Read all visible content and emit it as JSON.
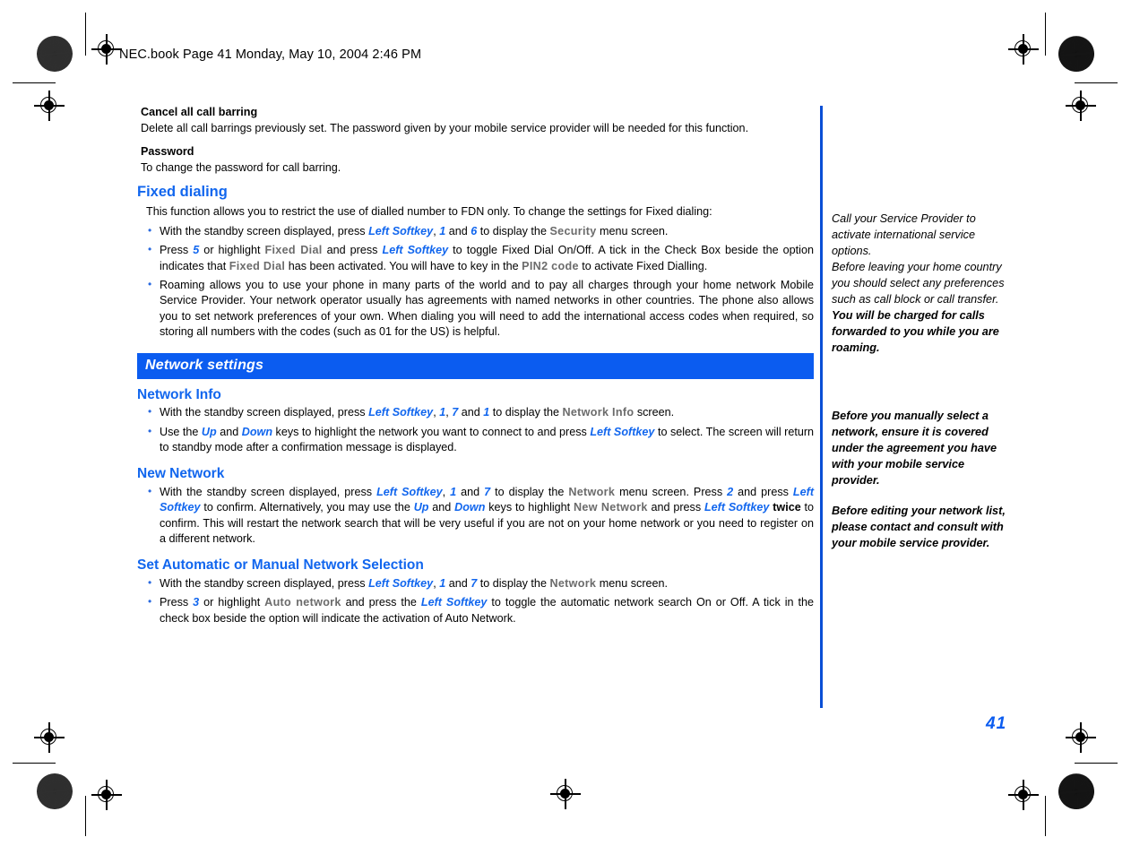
{
  "header": {
    "file_info": "NEC.book  Page 41  Monday, May 10, 2004  2:46 PM"
  },
  "page_number": "41",
  "colors": {
    "accent_blue": "#1166ee",
    "banner_blue": "#0b5cf0",
    "menu_gray": "#6b6b6b",
    "divider_blue": "#0a4fd6"
  },
  "content": {
    "cancel_barring": {
      "heading": "Cancel all call barring",
      "body": "Delete all call barrings previously set. The password given by your mobile service provider will be needed for this function."
    },
    "password": {
      "heading": "Password",
      "body": "To change the password for call barring."
    },
    "fixed_dialing": {
      "heading": "Fixed dialing",
      "intro": "This function allows you to restrict the use of dialled number to FDN only. To change the settings for Fixed dialing:",
      "bullet1": {
        "p1": "With the standby screen displayed, press ",
        "softkey": "Left Softkey",
        "p2": ", ",
        "n1": "1",
        "p3": " and ",
        "n2": "6",
        "p4": " to display the ",
        "menu": "Security",
        "p5": " menu screen."
      },
      "bullet2": {
        "p1": "Press ",
        "n1": "5",
        "p2": " or highlight ",
        "menu1": "Fixed Dial",
        "p3": " and press ",
        "softkey": "Left Softkey",
        "p4": " to toggle Fixed Dial On/Off. A tick in the Check Box beside the option indicates that ",
        "menu2": "Fixed Dial",
        "p5": " has been activated. You will have to key in the ",
        "menu3": "PIN2 code",
        "p6": " to activate Fixed Dialling."
      },
      "bullet3": {
        "text": "Roaming allows you to use your phone in many parts of the world and to pay all charges through your home network Mobile Service Provider. Your network operator usually has agreements with named networks in other countries. The phone also allows you to set network preferences of your own. When dialing you will need to add the international access codes when required, so storing all numbers with the codes (such as 01 for the US) is helpful."
      }
    },
    "network_settings_banner": "Network settings",
    "network_info": {
      "heading": "Network Info",
      "bullet1": {
        "p1": "With the standby screen displayed, press ",
        "softkey": "Left Softkey",
        "p2": ", ",
        "n1": "1",
        "p3": ", ",
        "n2": "7",
        "p4": " and ",
        "n3": "1",
        "p5": " to display the ",
        "menu": "Network Info",
        "p6": " screen."
      },
      "bullet2": {
        "p1": "Use the ",
        "key1": "Up",
        "p2": " and ",
        "key2": "Down",
        "p3": " keys to highlight the network you want to connect to and press ",
        "softkey": "Left Softkey",
        "p4": " to select. The screen will return to standby mode after a confirmation message is displayed."
      }
    },
    "new_network": {
      "heading": "New Network",
      "bullet1": {
        "p1": "With the standby screen displayed, press ",
        "softkey1": "Left Softkey",
        "p2": ", ",
        "n1": "1",
        "p3": " and ",
        "n2": "7",
        "p4": " to display the ",
        "menu1": "Network",
        "p5": " menu screen. Press ",
        "n3": "2",
        "p6": " and press ",
        "softkey2": "Left Softkey",
        "p7": " to confirm. Alternatively, you may use the ",
        "key1": "Up",
        "p8": " and ",
        "key2": "Down",
        "p9": " keys to highlight ",
        "menu2": "New Network",
        "p10": " and press ",
        "softkey3": "Left Softkey",
        "p11": " ",
        "twice": "twice",
        "p12": " to confirm. This will restart the network search that will be very useful if you are not on your home network or you need to register on a different network."
      }
    },
    "auto_manual": {
      "heading": "Set Automatic or Manual Network Selection",
      "bullet1": {
        "p1": "With the standby screen displayed, press ",
        "softkey": "Left Softkey",
        "p2": ", ",
        "n1": "1",
        "p3": " and ",
        "n2": "7",
        "p4": " to display the ",
        "menu": "Network",
        "p5": " menu screen."
      },
      "bullet2": {
        "p1": "Press ",
        "n1": "3",
        "p2": " or highlight ",
        "menu": "Auto network",
        "p3": " and press the ",
        "softkey": "Left Softkey",
        "p4": " to toggle the automatic network search On or Off. A tick in the check box beside the option will indicate the activation of Auto Network."
      }
    }
  },
  "sidebar": {
    "note1_plain": "Call your Service Provider to activate international service options.",
    "note1_plain2": "Before leaving your home country you should select any preferences such as call block or call transfer.",
    "note1_bold": "You will be charged for calls forwarded to you while you are roaming.",
    "note2_bold": "Before you manually select a network, ensure it is covered under the agreement you have with your mobile service provider.",
    "note3_bold": "Before editing your network list, please contact and consult with your mobile service provider."
  }
}
